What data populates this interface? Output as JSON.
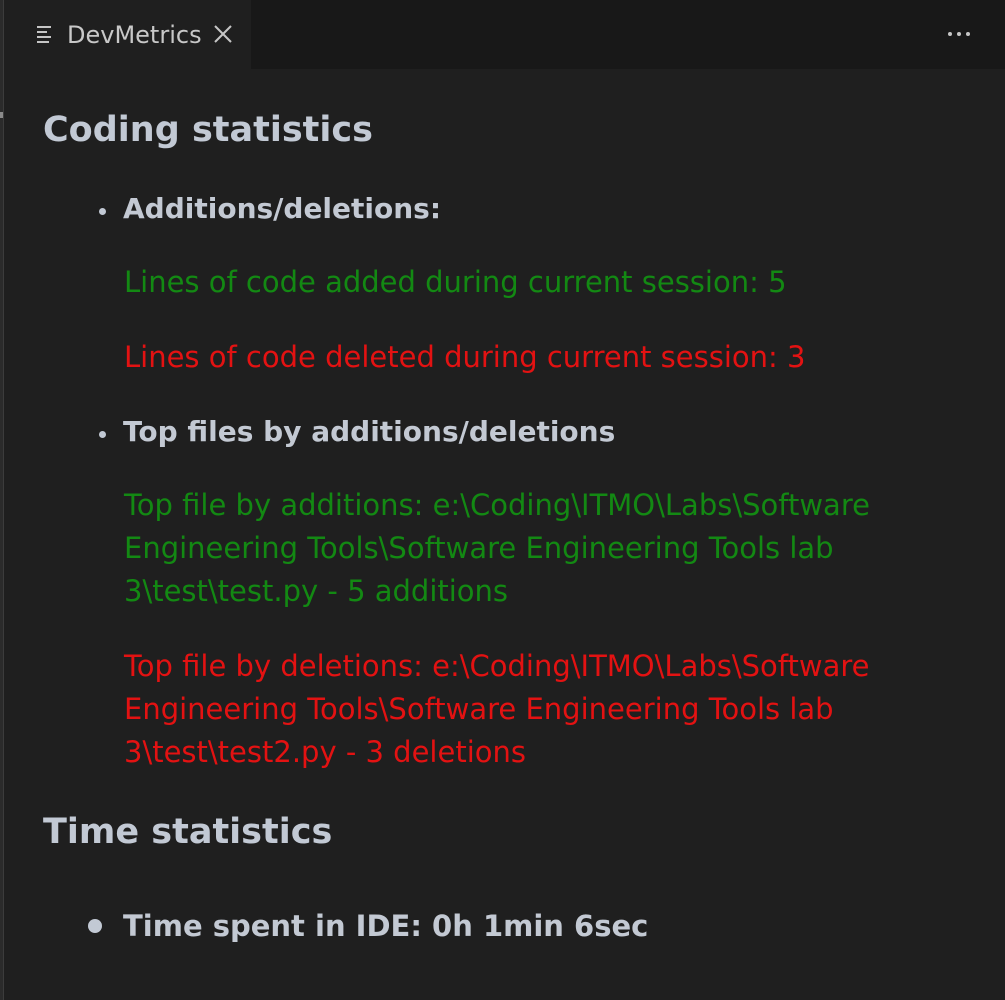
{
  "tab": {
    "title": "DevMetrics",
    "icon": "preview-icon",
    "close_icon": "close-icon"
  },
  "toolbar": {
    "more_actions_icon": "more-actions-icon"
  },
  "colors": {
    "background": "#1f1f1f",
    "additions": "#138913",
    "deletions": "#e31212",
    "heading": "#c2c9d4"
  },
  "coding_statistics": {
    "heading": "Coding statistics",
    "additions_deletions": {
      "label": "Additions/deletions:",
      "added_line": "Lines of code added during current session: 5",
      "deleted_line": "Lines of code deleted during current session: 3"
    },
    "top_files": {
      "label": "Top files by additions/deletions",
      "top_by_additions": "Top file by additions: e:\\Coding\\ITMO\\Labs\\Software Engineering Tools\\Software Engineering Tools lab 3\\test\\test.py - 5 additions",
      "top_by_deletions": "Top file by deletions: e:\\Coding\\ITMO\\Labs\\Software Engineering Tools\\Software Engineering Tools lab 3\\test\\test2.py - 3 deletions"
    }
  },
  "time_statistics": {
    "heading": "Time statistics",
    "time_spent": "Time spent in IDE: 0h 1min 6sec"
  }
}
